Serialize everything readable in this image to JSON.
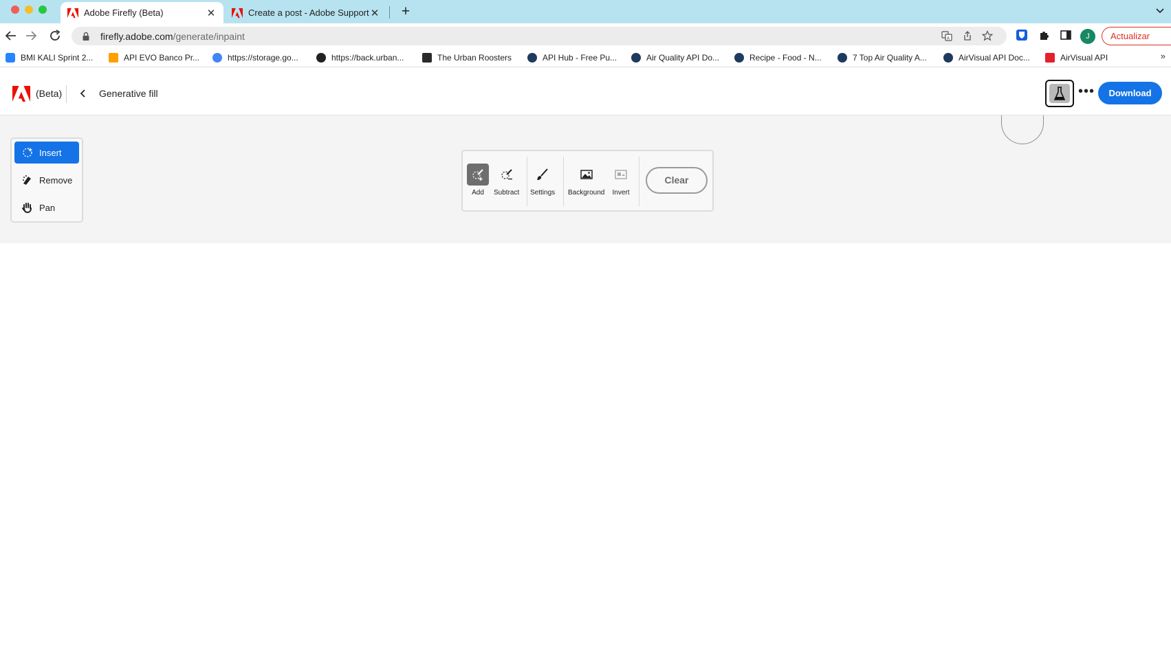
{
  "browser": {
    "tabs": [
      {
        "title": "Adobe Firefly (Beta)",
        "active": true
      },
      {
        "title": "Create a post - Adobe Support",
        "active": false
      }
    ],
    "url_host": "firefly.adobe.com",
    "url_path": "/generate/inpaint",
    "update_label": "Actualizar",
    "profile_initial": "J",
    "bookmarks": [
      "BMI KALI Sprint 2...",
      "API EVO Banco Pr...",
      "https://storage.go...",
      "https://back.urban...",
      "The Urban Roosters",
      "API Hub - Free Pu...",
      "Air Quality API Do...",
      "Recipe - Food - N...",
      "7 Top Air Quality A...",
      "AirVisual API Doc...",
      "AirVisual API"
    ]
  },
  "app": {
    "beta_label": "(Beta)",
    "page_title": "Generative fill",
    "download_label": "Download",
    "more_label": "•••"
  },
  "tool_rail": {
    "items": [
      {
        "label": "Insert",
        "active": true
      },
      {
        "label": "Remove",
        "active": false
      },
      {
        "label": "Pan",
        "active": false
      }
    ]
  },
  "brush_panel": {
    "tools": [
      {
        "label": "Add",
        "selected": true
      },
      {
        "label": "Subtract",
        "selected": false
      },
      {
        "label": "Settings",
        "selected": false
      },
      {
        "label": "Background",
        "selected": false
      },
      {
        "label": "Invert",
        "selected": false
      }
    ],
    "clear_label": "Clear"
  },
  "colors": {
    "accent": "#1473e6",
    "tabbar": "#b7e3f0",
    "adobe_red": "#eb1000",
    "update_red": "#d93025"
  }
}
